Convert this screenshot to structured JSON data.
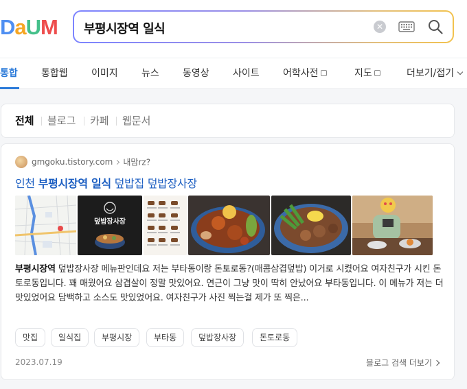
{
  "header": {
    "logo_letters": [
      "D",
      "a",
      "U",
      "M"
    ],
    "logo_colors": [
      "#4f8ff2",
      "#f6a623",
      "#45c08a",
      "#ee4d4d"
    ],
    "search_query": "부평시장역 일식"
  },
  "tabs": [
    {
      "label": "통합",
      "active": true
    },
    {
      "label": "통합웹"
    },
    {
      "label": "이미지"
    },
    {
      "label": "뉴스"
    },
    {
      "label": "동영상"
    },
    {
      "label": "사이트"
    },
    {
      "label": "어학사전",
      "external": true
    },
    {
      "label": "지도",
      "external": true
    },
    {
      "label": "더보기/접기"
    }
  ],
  "filters": [
    "전체",
    "블로그",
    "카페",
    "웹문서"
  ],
  "result": {
    "source_domain": "gmgoku.tistory.com",
    "source_name": "내맘rz?",
    "title_prefix": "인천 ",
    "title_highlight": "부평시장역 일식",
    "title_suffix": " 덮밥집 덮밥장사장",
    "snippet_highlight": "부평시장역",
    "snippet_text": " 덮밥장사장 메뉴판인데요 저는 부타동이랑 돈토로동?(매콤삼겹덮밥) 이거로 시켰어요 여자친구가 시킨 돈토로동입니다. 꽤 매웠어요 삼겹살이 정말 맛있어요. 연근이 그냥 맛이 딱히 안났어요 부타동입니다. 이 메뉴가 저는 더 맛있었어요 담백하고 소스도 맛있었어요. 여자친구가 사진 찍는걸 제가 또 찍은...",
    "sign_text": "덮밥장사장",
    "tags": [
      "맛집",
      "일식집",
      "부평시장",
      "부타동",
      "덮밥장사장",
      "돈토로동"
    ],
    "date": "2023.07.19",
    "more_label": "블로그 검색 더보기"
  }
}
